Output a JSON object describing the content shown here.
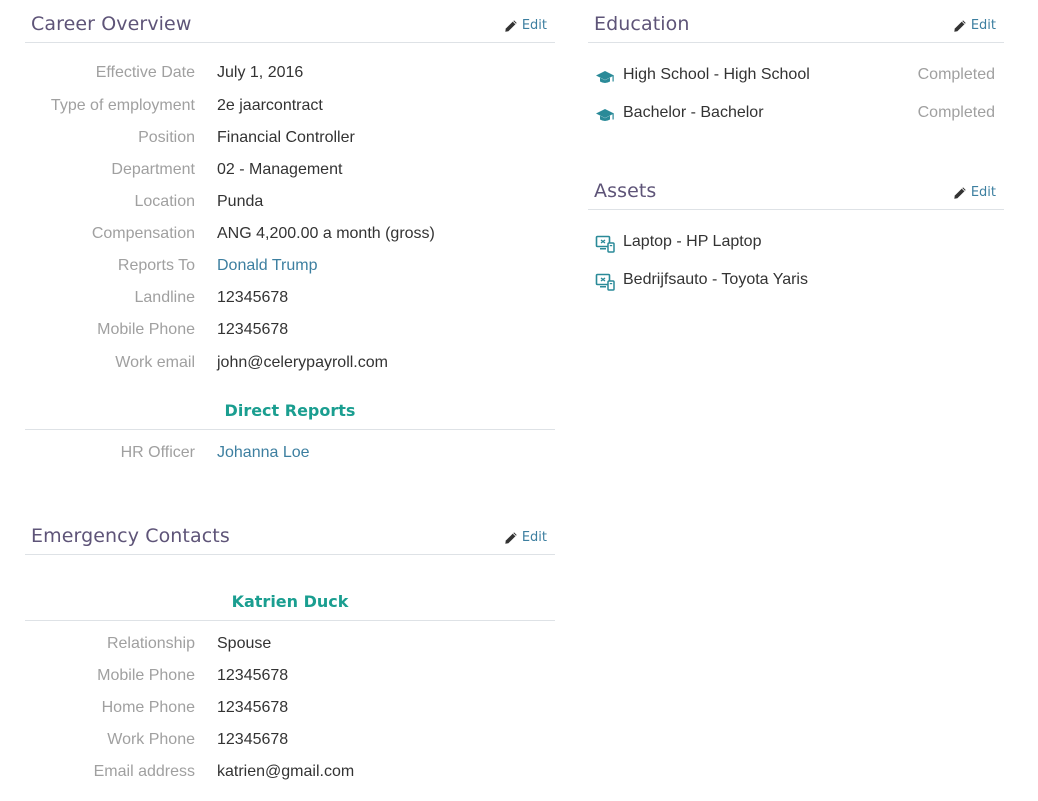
{
  "career": {
    "title": "Career Overview",
    "edit_label": "Edit",
    "fields": [
      {
        "label": "Effective Date",
        "value": "July 1, 2016"
      },
      {
        "label": "Type of employment",
        "value": "2e jaarcontract"
      },
      {
        "label": "Position",
        "value": "Financial Controller"
      },
      {
        "label": "Department",
        "value": "02 - Management"
      },
      {
        "label": "Location",
        "value": "Punda"
      },
      {
        "label": "Compensation",
        "value": "ANG 4,200.00 a month (gross)"
      },
      {
        "label": "Reports To",
        "value": "Donald Trump"
      },
      {
        "label": "Landline",
        "value": "12345678"
      },
      {
        "label": "Mobile Phone",
        "value": "12345678"
      },
      {
        "label": "Work email",
        "value": "john@celerypayroll.com"
      }
    ],
    "direct_reports": {
      "title": "Direct Reports",
      "items": [
        {
          "label": "HR Officer",
          "value": "Johanna Loe"
        }
      ]
    }
  },
  "emergency": {
    "title": "Emergency Contacts",
    "edit_label": "Edit",
    "contact_name": "Katrien Duck",
    "fields": [
      {
        "label": "Relationship",
        "value": "Spouse"
      },
      {
        "label": "Mobile Phone",
        "value": "12345678"
      },
      {
        "label": "Home Phone",
        "value": "12345678"
      },
      {
        "label": "Work Phone",
        "value": "12345678"
      },
      {
        "label": "Email address",
        "value": "katrien@gmail.com"
      }
    ]
  },
  "education": {
    "title": "Education",
    "edit_label": "Edit",
    "items": [
      {
        "label": "High School - High School",
        "status": "Completed",
        "icon": "graduation-cap-icon"
      },
      {
        "label": "Bachelor - Bachelor",
        "status": "Completed",
        "icon": "graduation-cap-icon"
      }
    ]
  },
  "assets": {
    "title": "Assets",
    "edit_label": "Edit",
    "items": [
      {
        "label": "Laptop - HP Laptop",
        "icon": "asset-icon"
      },
      {
        "label": "Bedrijfsauto - Toyota Yaris",
        "icon": "asset-icon"
      }
    ]
  },
  "colors": {
    "section_title": "#5e5478",
    "link": "#3d7fa0",
    "subheader": "#1a9e90",
    "label": "#a0a0a0",
    "icon": "#2a8a98"
  }
}
